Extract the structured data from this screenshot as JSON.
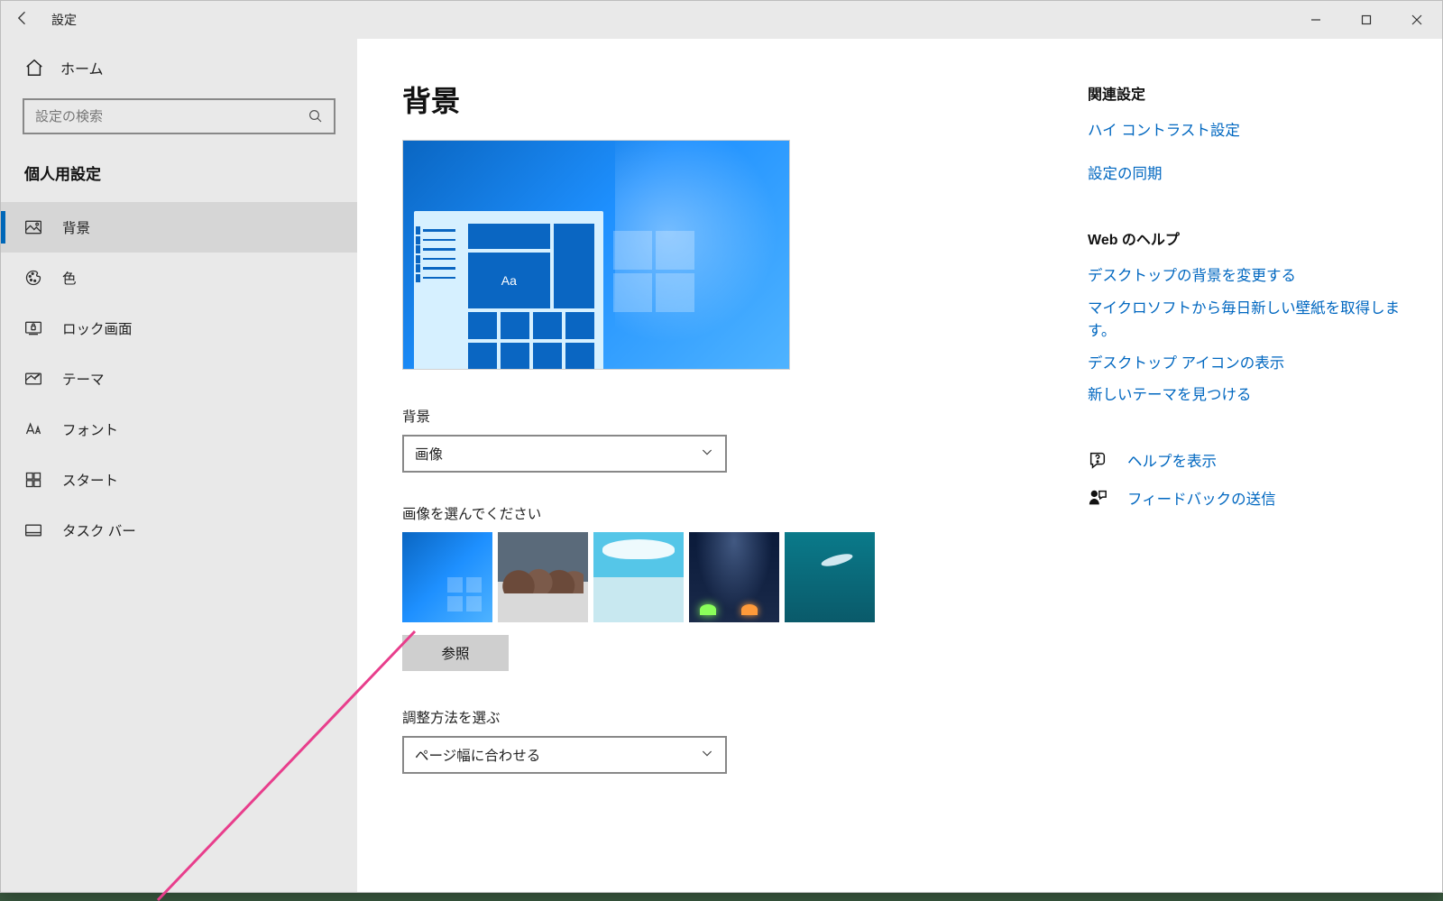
{
  "titlebar": {
    "title": "設定"
  },
  "sidebar": {
    "home": "ホーム",
    "search_placeholder": "設定の検索",
    "category": "個人用設定",
    "items": [
      {
        "label": "背景"
      },
      {
        "label": "色"
      },
      {
        "label": "ロック画面"
      },
      {
        "label": "テーマ"
      },
      {
        "label": "フォント"
      },
      {
        "label": "スタート"
      },
      {
        "label": "タスク バー"
      }
    ]
  },
  "main": {
    "heading": "背景",
    "preview_sample_text": "Aa",
    "bg_label": "背景",
    "bg_value": "画像",
    "choose_label": "画像を選んでください",
    "browse": "参照",
    "fit_label": "調整方法を選ぶ",
    "fit_value": "ページ幅に合わせる"
  },
  "right": {
    "related_header": "関連設定",
    "related_links": [
      "ハイ コントラスト設定",
      "設定の同期"
    ],
    "web_header": "Web のヘルプ",
    "web_links": [
      "デスクトップの背景を変更する",
      "マイクロソフトから毎日新しい壁紙を取得します。",
      "デスクトップ アイコンの表示",
      "新しいテーマを見つける"
    ],
    "help": "ヘルプを表示",
    "feedback": "フィードバックの送信"
  }
}
